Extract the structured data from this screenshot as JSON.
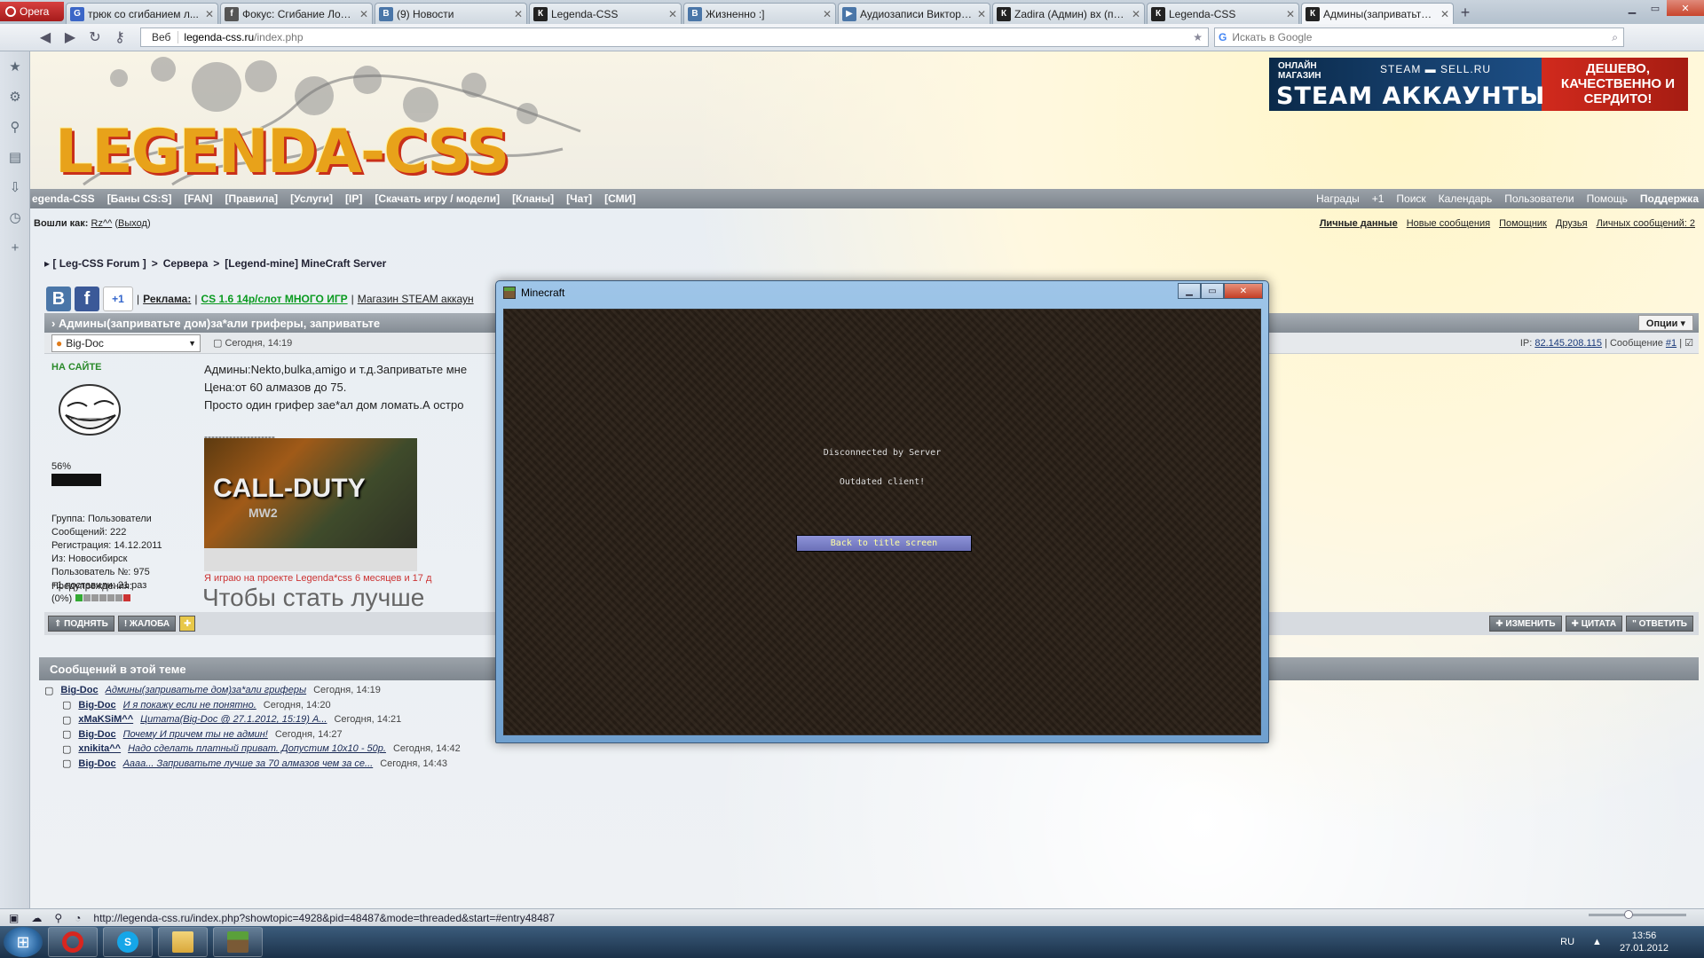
{
  "browser": {
    "opera_label": "Opera",
    "tabs": [
      {
        "title": "трюк со сгибанием л...",
        "favicon": "G",
        "color": "#3b66c7"
      },
      {
        "title": "Фокус: Сгибание Лож...",
        "favicon": "f",
        "color": "#555555"
      },
      {
        "title": "(9) Новости",
        "favicon": "В",
        "color": "#4a76a8"
      },
      {
        "title": "Legenda-CSS",
        "favicon": "К",
        "color": "#222222"
      },
      {
        "title": "Жизненно :]",
        "favicon": "В",
        "color": "#4a76a8"
      },
      {
        "title": "Аудиозаписи Виктора ...",
        "favicon": "▶",
        "color": "#4a76a8"
      },
      {
        "title": "Zadira (Админ) вх (пус...",
        "favicon": "К",
        "color": "#222222"
      },
      {
        "title": "Legenda-CSS",
        "favicon": "К",
        "color": "#222222"
      },
      {
        "title": "Админы(заприватьте ...",
        "favicon": "К",
        "color": "#222222",
        "active": true
      }
    ],
    "web_label": "Веб",
    "url_host": "legenda-css.ru",
    "url_path": "/index.php",
    "search_placeholder": "Искать в Google",
    "status_url": "http://legenda-css.ru/index.php?showtopic=4928&pid=48487&mode=threaded&start=#entry48487"
  },
  "site": {
    "logo": "LEGENDA-CSS",
    "banner": {
      "small": "ОНЛАЙН МАГАЗИН",
      "steam": "STEAM ▬ SELL.RU",
      "big": "STEAM АККАУНТЫ",
      "right": "ДЕШЕВО, КАЧЕСТВЕННО И СЕРДИТО!"
    },
    "nav_left": [
      "egenda-CSS",
      "[Баны CS:S]",
      "[FAN]",
      "[Правила]",
      "[Услуги]",
      "[IP]",
      "[Скачать игру / модели]",
      "[Кланы]",
      "[Чат]",
      "[СМИ]"
    ],
    "nav_right": [
      "Награды",
      "+1",
      "Поиск",
      "Календарь",
      "Пользователи",
      "Помощь",
      "Поддержка"
    ],
    "logged_in_prefix": "Вошли как:",
    "logged_in_user": "Rz^^",
    "logout": "Выход",
    "user_links": [
      "Личные данные",
      "Новые сообщения",
      "Помощник",
      "Друзья",
      "Личных сообщений: 2"
    ],
    "breadcrumb": [
      "▸ [ Leg-CSS Forum ]",
      ">",
      "Сервера",
      ">",
      "[Legend-mine] MineCraft Server"
    ],
    "social": {
      "vk": "B",
      "fb": "f",
      "plus": "+1"
    },
    "ad_label": "Реклама:",
    "ad1": "CS 1.6 14р/слот МНОГО ИГР",
    "ad2": "Магазин STEAM аккаун",
    "topic_title": "› Админы(заприватьте дом)за*али гриферы, заприватьте",
    "options_button": "Опции ▾",
    "post": {
      "author": "Big-Doc",
      "date": "Сегодня, 14:19",
      "ip_label": "IP:",
      "ip": "82.145.208.115",
      "msg_label": "| Сообщение",
      "msg_no": "#1",
      "online": "НА САЙТЕ",
      "reputation": "56%",
      "stats": [
        "Группа: Пользователи",
        "Сообщений: 222",
        "Регистрация: 14.12.2011",
        "Из: Новосибирск",
        "Пользователь №: 975",
        "+1 поставили: 21 раз"
      ],
      "warnings_label": "Предупреждения:",
      "warnings_value": "(0%)",
      "body": [
        "Админы:Nekto,bulka,amigo и т.д.Заприватьте мне",
        "Цена:от 60 алмазов до 75.",
        "Просто один грифер зае*ал дом ломать.А остро"
      ],
      "sig_separator": "--------------------",
      "sig_game_title": "CALL-DUTY",
      "sig_game_sub": "MW2",
      "sig_red": "Я играю на проекте Legenda*css 6 месяцев и 17 д",
      "sig_big": "Чтобы стать лучше"
    },
    "post_buttons_left": [
      "⇑ ПОДНЯТЬ",
      "! ЖАЛОБА"
    ],
    "post_buttons_right": [
      "✚ ИЗМЕНИТЬ",
      "✚ ЦИТАТА",
      "\" ОТВЕТИТЬ"
    ],
    "thread_title": "Сообщений в этой теме",
    "thread": [
      {
        "user": "Big-Doc",
        "msg": "Админы(заприватьте дом)за*али гриферы",
        "time": "Сегодня, 14:19",
        "indent": false
      },
      {
        "user": "Big-Doc",
        "msg": "И я покажу если не понятно.",
        "time": "Сегодня, 14:20",
        "indent": true
      },
      {
        "user": "xMaKSiM^^",
        "msg": "Цитата(Big-Doc @ 27.1.2012, 15:19) А...",
        "time": "Сегодня, 14:21",
        "indent": true
      },
      {
        "user": "Big-Doc",
        "msg": "Почему И причем ты не админ!",
        "time": "Сегодня, 14:27",
        "indent": true
      },
      {
        "user": "xnikita^^",
        "msg": "Надо сделать платный приват. Допустим 10х10 - 50р.",
        "time": "Сегодня, 14:42",
        "indent": true
      },
      {
        "user": "Big-Doc",
        "msg": "Аааа... Заприватьте лучше за 70 алмазов чем за се...",
        "time": "Сегодня, 14:43",
        "indent": true
      }
    ]
  },
  "minecraft": {
    "window_title": "Minecraft",
    "line1": "Disconnected by Server",
    "line2": "Outdated client!",
    "button": "Back to title screen"
  },
  "taskbar": {
    "lang": "RU",
    "time": "13:56",
    "date": "27.01.2012"
  }
}
